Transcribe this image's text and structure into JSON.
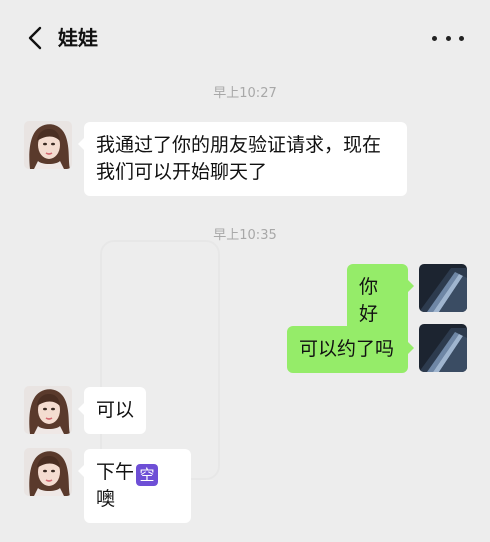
{
  "header": {
    "title": "娃娃"
  },
  "colors": {
    "background": "#ededed",
    "incoming_bubble": "#ffffff",
    "outgoing_bubble": "#95ec69",
    "timestamp": "#a8a8a8",
    "emoji_badge": "#6e4fd6"
  },
  "messages": {
    "ts1": "早上10:27",
    "m1_line1": "我通过了你的朋友验证请求，现在",
    "m1_line2": "我们可以开始聊天了",
    "ts2": "早上10:35",
    "m2": "你好",
    "m3": "可以约了吗",
    "m4": "可以",
    "m5_pre": "下午",
    "m5_badge": "空",
    "m5_post": "噢"
  },
  "icons": {
    "back": "chevron-left-icon",
    "more": "more-dots-icon",
    "contact_avatar": "girl-photo-avatar",
    "self_avatar": "dark-phone-avatar"
  }
}
